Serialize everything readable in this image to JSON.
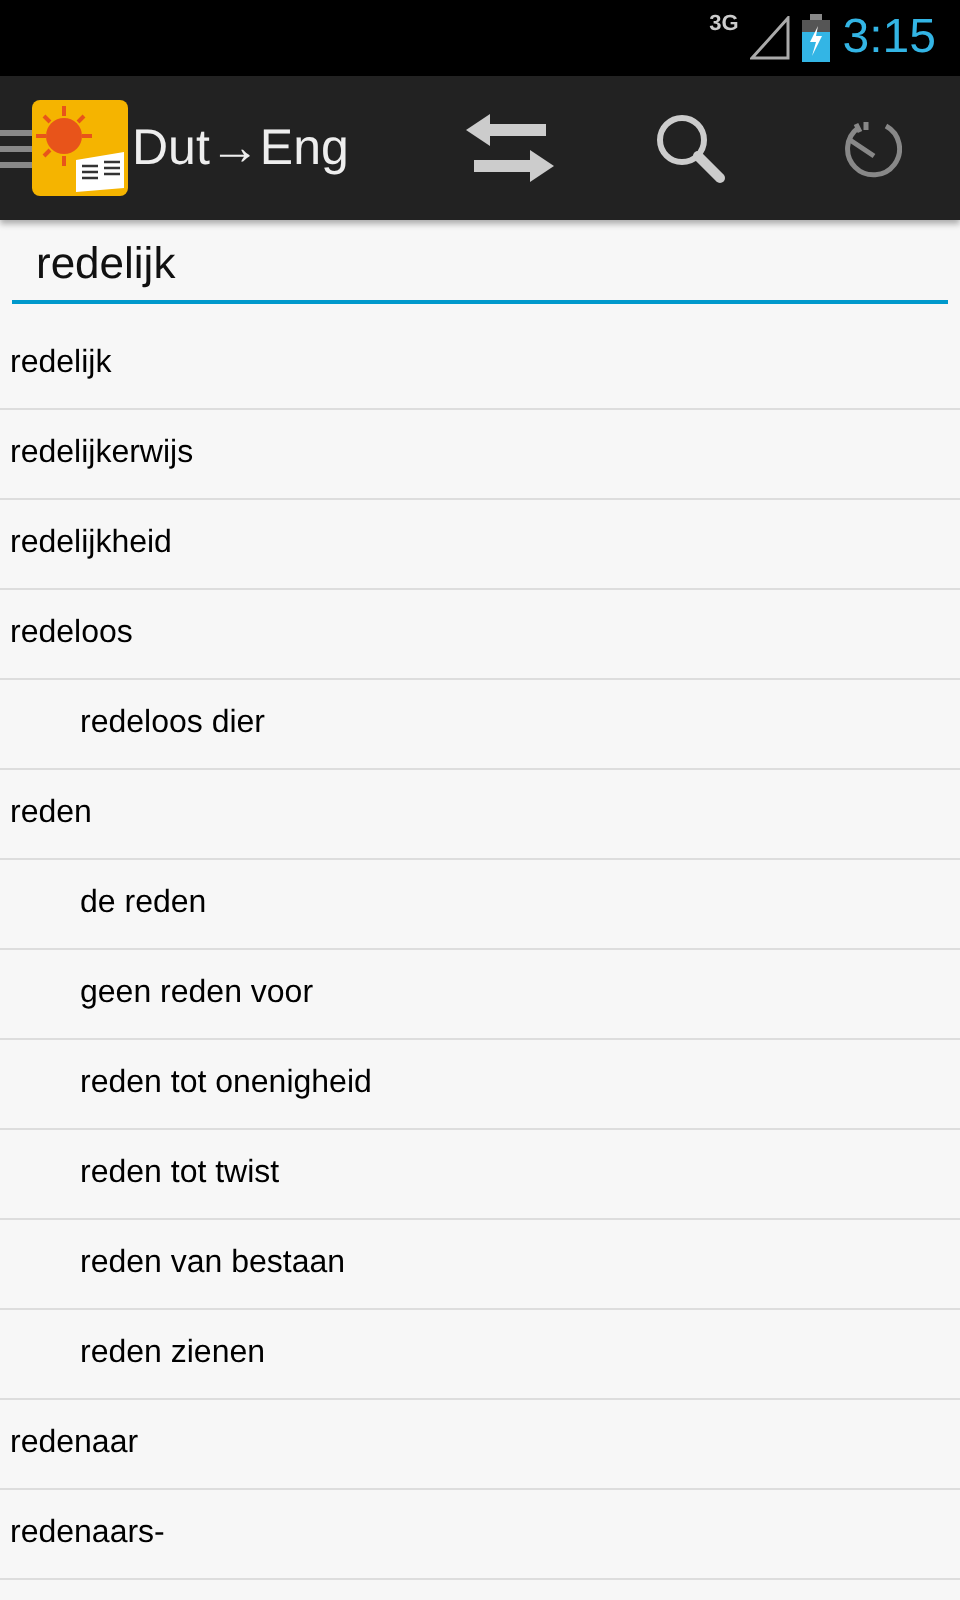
{
  "status_bar": {
    "network": "3G",
    "time": "3:15"
  },
  "action_bar": {
    "title": "Dut→Eng"
  },
  "search": {
    "value": "redelijk"
  },
  "entries": [
    {
      "word": "redelijk"
    },
    {
      "word": "redelijkerwijs"
    },
    {
      "word": "redelijkheid"
    },
    {
      "word": "redeloos",
      "children": [
        {
          "word": "redeloos dier"
        }
      ]
    },
    {
      "word": "reden",
      "children": [
        {
          "word": "de reden"
        },
        {
          "word": "geen reden voor"
        },
        {
          "word": "reden tot onenigheid"
        },
        {
          "word": "reden tot twist"
        },
        {
          "word": "reden van bestaan"
        },
        {
          "word": "reden zienen"
        }
      ]
    },
    {
      "word": "redenaar"
    },
    {
      "word": "redenaars-"
    }
  ]
}
